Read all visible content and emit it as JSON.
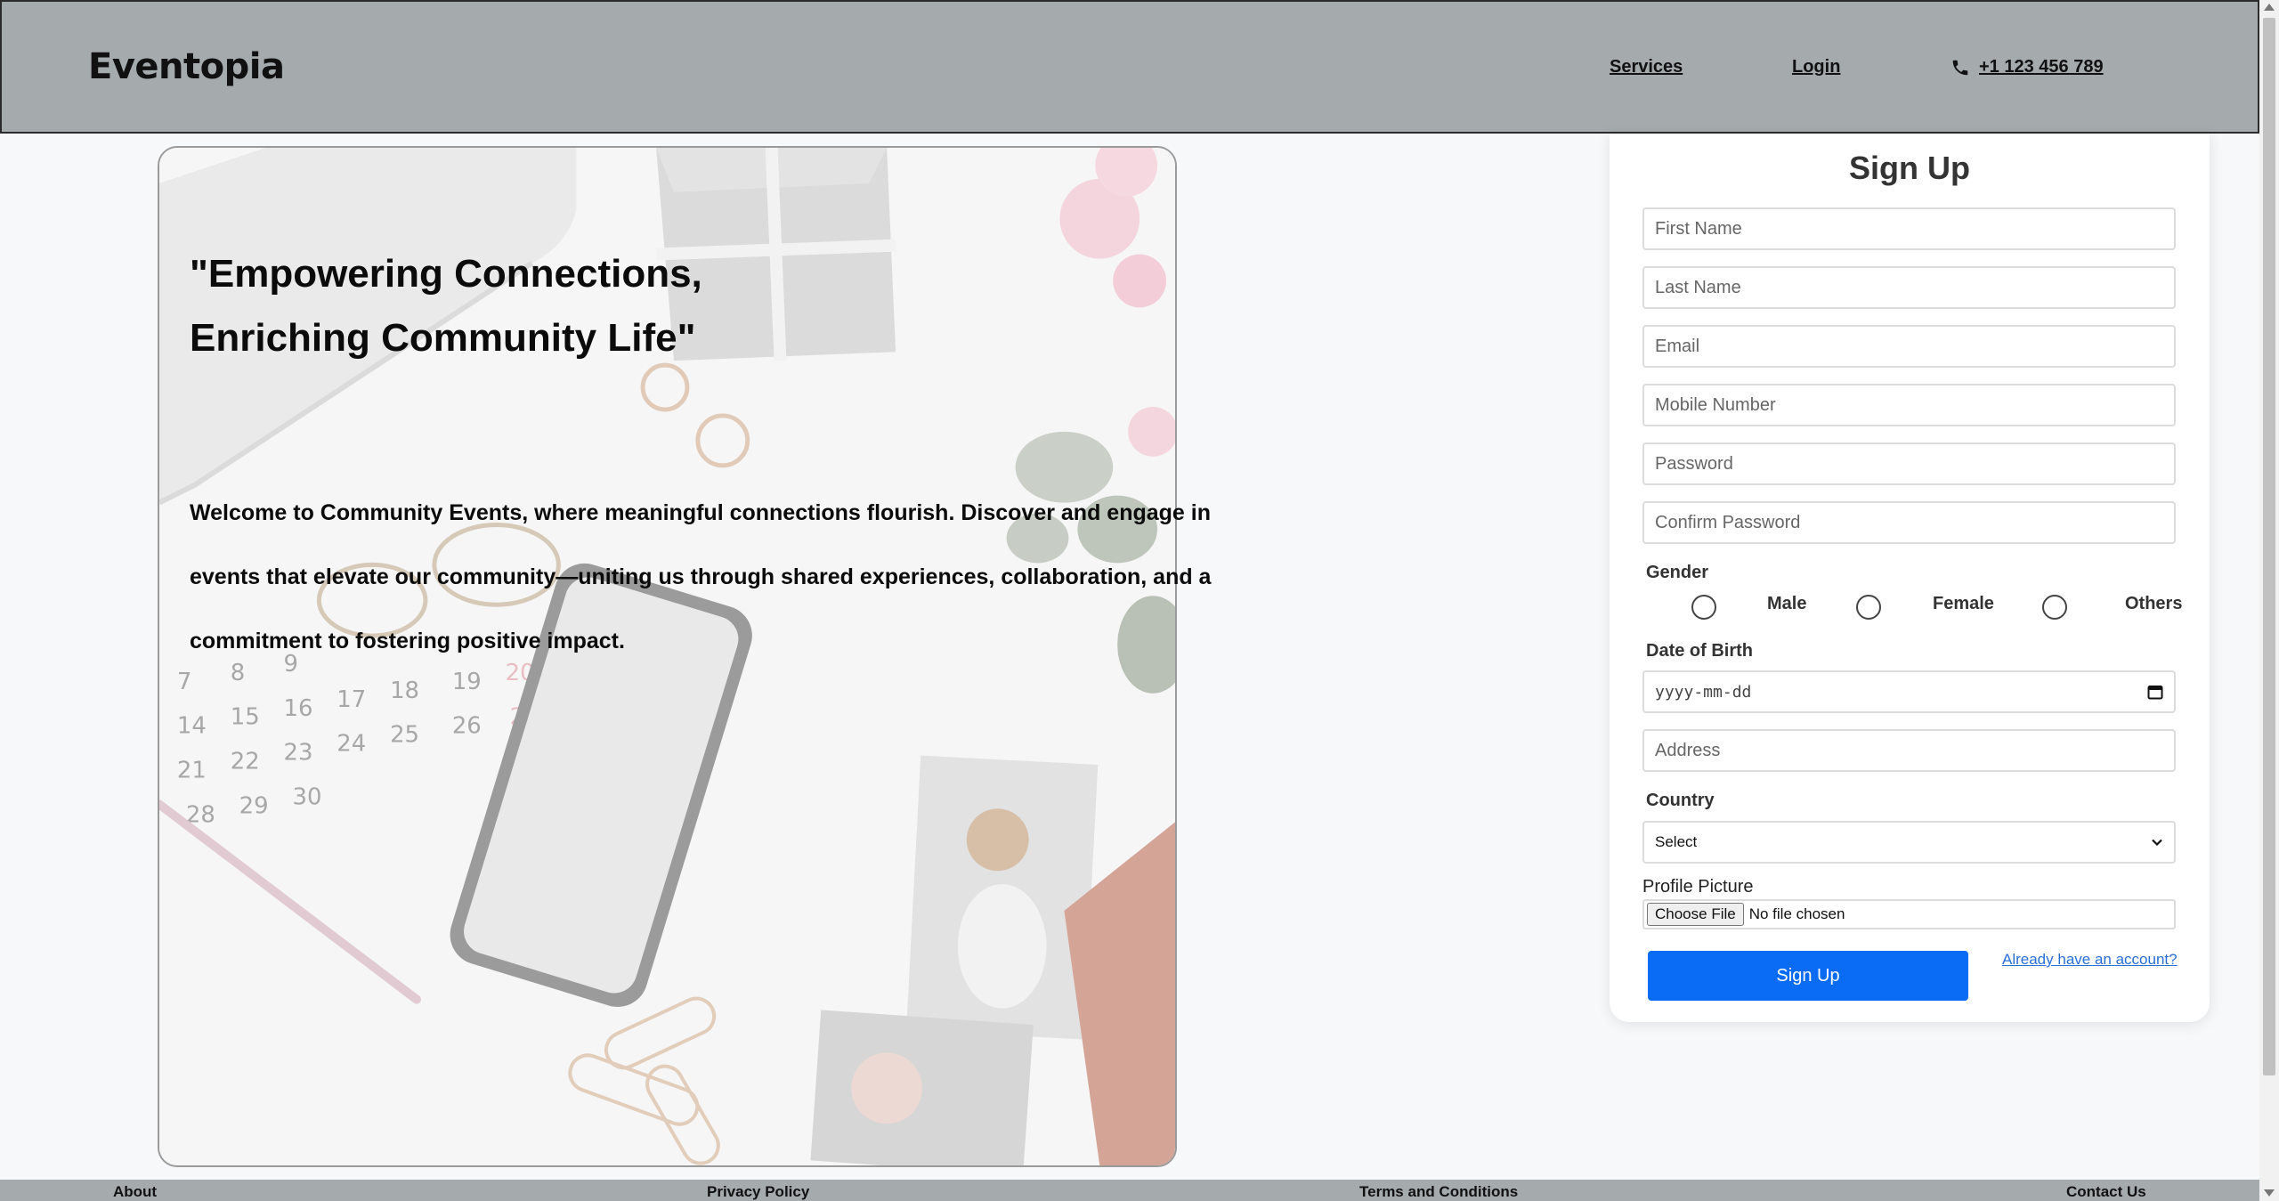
{
  "header": {
    "brand": "Eventopia",
    "nav": {
      "services": "Services",
      "login": "Login",
      "phone": "+1 123 456 789"
    },
    "phone_icon": "phone-icon"
  },
  "hero": {
    "title_line1": "\"Empowering Connections,",
    "title_line2": "Enriching Community Life\"",
    "text": "Welcome to Community Events, where meaningful connections flourish. Discover and engage in events that elevate our community—uniting us through shared experiences, collaboration, and a commitment to fostering positive impact."
  },
  "signup": {
    "title": "Sign Up",
    "first_name_placeholder": "First Name",
    "last_name_placeholder": "Last Name",
    "email_placeholder": "Email",
    "mobile_placeholder": "Mobile Number",
    "password_placeholder": "Password",
    "confirm_password_placeholder": "Confirm Password",
    "gender_label": "Gender",
    "gender_options": [
      "Male",
      "Female",
      "Others"
    ],
    "dob_label": "Date of Birth",
    "dob_placeholder": "yyyy-mm-dd",
    "address_placeholder": "Address",
    "country_label": "Country",
    "country_selected": "Select",
    "profile_label": "Profile Picture",
    "file_button": "Choose File",
    "file_status": "No file chosen",
    "submit_label": "Sign Up",
    "login_link": "Already have an account?"
  },
  "footer": {
    "about": "About",
    "privacy": "Privacy Policy",
    "terms": "Terms and Conditions",
    "contact": "Contact Us"
  },
  "colors": {
    "header_bg": "#a5aaad",
    "button_blue": "#0a6cf5",
    "link_blue": "#2a6fd6"
  }
}
